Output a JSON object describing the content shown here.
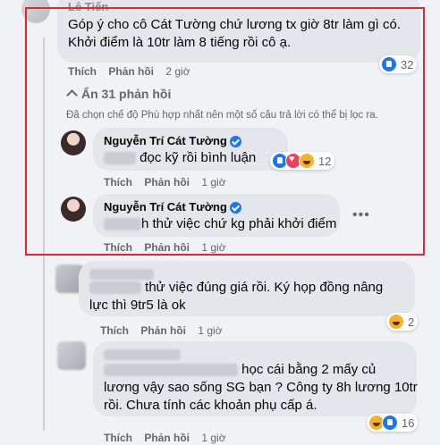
{
  "colors": {
    "highlight_border": "#e0282e",
    "link_blue": "#1877f2",
    "bubble": "#e4e6eb",
    "background": "#f0f2f5"
  },
  "comments": [
    {
      "author_partial": "Lê Tiến",
      "text_line1": "Góp ý cho cô Cát Tường chứ lương tx giờ 8tr làm gì có.",
      "text_line2": "Khởi điểm là 10tr làm 8 tiếng rồi cô ạ.",
      "like_label": "Thích",
      "reply_label": "Phản hồi",
      "time": "2 giờ",
      "reaction_icons": [
        "like"
      ],
      "reaction_count": "32"
    }
  ],
  "hide_replies": {
    "label": "Ẩn 31 phản hồi",
    "icon": "chevron-up-icon"
  },
  "filter_note": "Đã chọn chế độ Phù hợp nhất nên một số câu trả lời có thể bị lọc ra.",
  "replies": [
    {
      "author": "Nguyễn Trí Cát Tường",
      "verified": true,
      "text": "đọc kỹ rồi bình luận",
      "like_label": "Thích",
      "reply_label": "Phản hồi",
      "time": "1 giờ",
      "reaction_icons": [
        "like",
        "love",
        "haha"
      ],
      "reaction_count": "12"
    },
    {
      "author": "Nguyễn Trí Cát Tường",
      "verified": true,
      "text": "h thử việc chứ kg phải khởi điểm",
      "like_label": "Thích",
      "reply_label": "Phản hồi",
      "time": "1 giờ",
      "more_icon": "more-icon"
    }
  ],
  "others": [
    {
      "text_line1": "thử việc đúng giá rồi. Ký họp đồng nâng",
      "text_line2": "lực thì 9tr5 là ok",
      "like_label": "Thích",
      "reply_label": "Phản hồi",
      "time": "1 giờ",
      "reaction_icons": [
        "haha"
      ],
      "reaction_count": "2"
    },
    {
      "text_line1": "học cái bằng 2 mấy củ",
      "text_line2": "lương vậy sao sống SG bạn ? Công ty 8h lương 10tr",
      "text_line3": "rồi. Chưa tính các khoản phụ cấp á.",
      "like_label": "Thích",
      "reply_label": "Phản hồi",
      "time": "1 giờ",
      "reaction_icons": [
        "haha",
        "like"
      ],
      "reaction_count": "16"
    }
  ]
}
